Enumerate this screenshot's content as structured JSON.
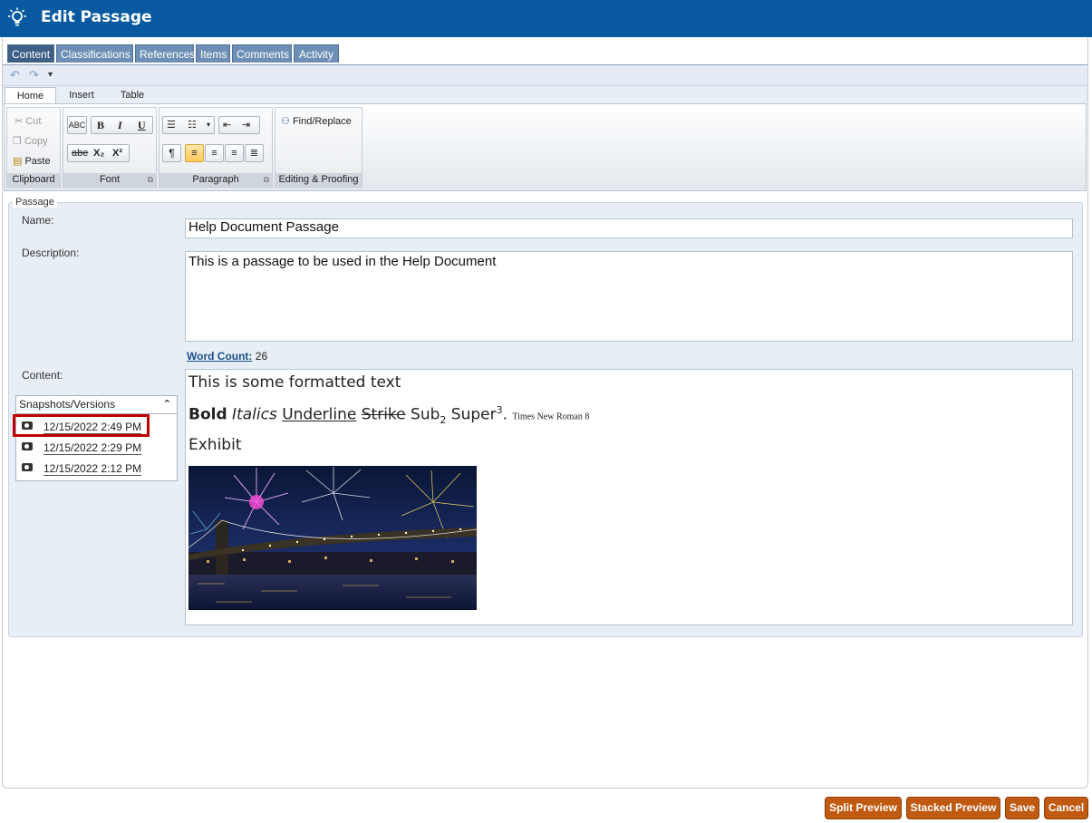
{
  "header": {
    "title": "Edit Passage",
    "icon": "lightbulb-icon"
  },
  "tabs": [
    "Content",
    "Classifications",
    "References",
    "Items",
    "Comments",
    "Activity"
  ],
  "active_tab": "Content",
  "ribbon": {
    "tabs": [
      "Home",
      "Insert",
      "Table"
    ],
    "clipboard": {
      "cut": "Cut",
      "copy": "Copy",
      "paste": "Paste",
      "label": "Clipboard"
    },
    "font": {
      "label": "Font",
      "bold": "B",
      "italic": "I",
      "underline": "U",
      "strike": "abe",
      "sub": "X₂",
      "sup": "X²"
    },
    "paragraph": {
      "label": "Paragraph"
    },
    "editing": {
      "find_replace": "Find/Replace",
      "label": "Editing & Proofing"
    }
  },
  "form": {
    "legend": "Passage",
    "name_label": "Name:",
    "name_value": "Help Document Passage",
    "description_label": "Description:",
    "description_value": "This is a passage to be used in the Help Document",
    "word_count_label": "Word Count:",
    "word_count": "26",
    "content_label": "Content:"
  },
  "content": {
    "line1": "This is some formatted text",
    "bold": "Bold",
    "italics": "Italics",
    "underline": "Underline",
    "strike": "Strike",
    "sub_base": "Sub",
    "sub": "2",
    "sup_base": "Super",
    "sup": "3",
    "period": ".",
    "small_font": "Times New Roman 8",
    "exhibit": "Exhibit"
  },
  "snapshots": {
    "title": "Snapshots/Versions",
    "items": [
      "12/15/2022 2:49 PM",
      "12/15/2022 2:29 PM",
      "12/15/2022 2:12 PM"
    ]
  },
  "buttons": {
    "split_preview": "Split Preview",
    "stacked_preview": "Stacked Preview",
    "save": "Save",
    "cancel": "Cancel"
  },
  "colors": {
    "header": "#08599f",
    "button": "#c05a10",
    "highlight": "#c00000",
    "panel": "#e8eef5"
  }
}
